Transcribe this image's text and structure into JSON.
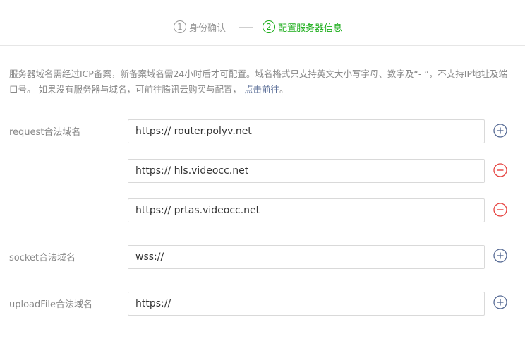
{
  "steps": [
    {
      "num": "1",
      "label": "身份确认"
    },
    {
      "num": "2",
      "label": "配置服务器信息"
    }
  ],
  "notice": {
    "text": "服务器域名需经过ICP备案，新备案域名需24小时后才可配置。域名格式只支持英文大小写字母、数字及“- ”，不支持IP地址及端口号。 如果没有服务器与域名，可前往腾讯云购买与配置，",
    "link": "点击前往",
    "end": "。"
  },
  "request": {
    "label": "request合法域名",
    "entries": [
      "https:// router.polyv.net",
      "https:// hls.videocc.net",
      "https:// prtas.videocc.net"
    ]
  },
  "socket": {
    "label": "socket合法域名",
    "value": "wss://"
  },
  "upload": {
    "label": "uploadFile合法域名",
    "value": "https://"
  },
  "colors": {
    "active_step": "#1aad19",
    "add_icon": "#576b95",
    "remove_icon": "#e64340",
    "link": "#576b95"
  }
}
